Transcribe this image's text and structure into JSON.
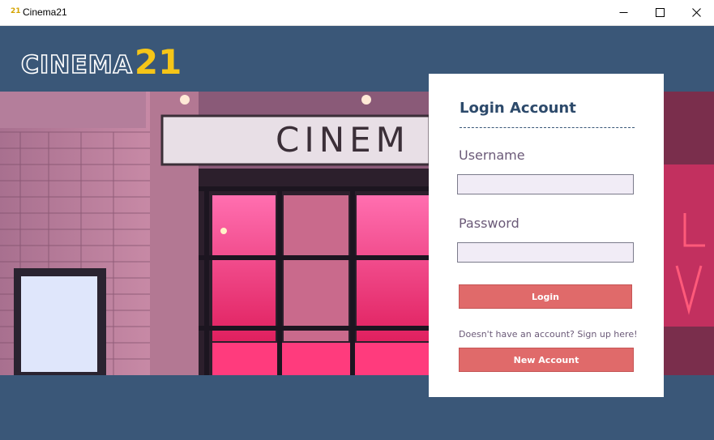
{
  "window": {
    "icon_text": "21",
    "title": "Cinema21",
    "controls": {
      "minimize": "minimize-icon",
      "maximize": "maximize-icon",
      "close": "close-icon"
    }
  },
  "header": {
    "logo_word": "CINEMA",
    "logo_number": "21"
  },
  "colors": {
    "brand_blue": "#3a5778",
    "accent_red": "#e06a6a",
    "logo_yellow": "#f5c518",
    "field_bg": "#f1ecf6"
  },
  "background_photo": {
    "sign_text": "CINEM"
  },
  "login": {
    "title": "Login Account",
    "divider": "------------------------------------",
    "username_label": "Username",
    "username_value": "",
    "password_label": "Password",
    "password_value": "",
    "login_button": "Login",
    "signup_prompt": "Doesn't have an account? Sign up here!",
    "new_account_button": "New Account"
  }
}
